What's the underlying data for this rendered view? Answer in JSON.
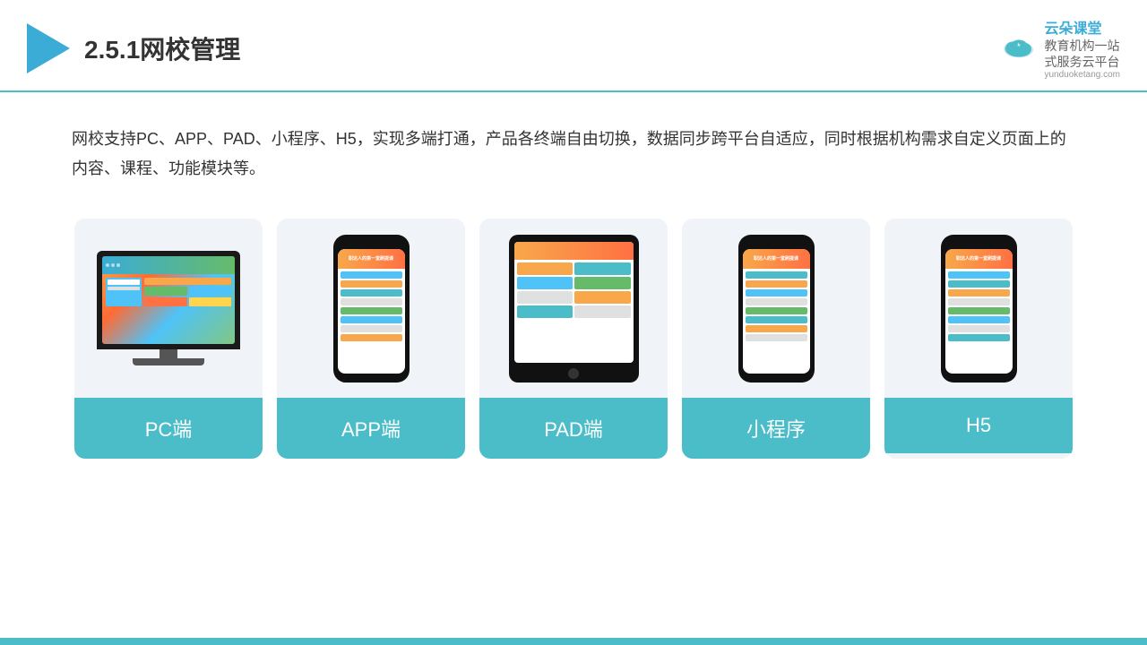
{
  "header": {
    "title": "2.5.1网校管理",
    "brand": {
      "name": "云朵课堂",
      "tagline": "教育机构一站\n式服务云平台",
      "url": "yunduoketang.com"
    }
  },
  "description": {
    "text": "网校支持PC、APP、PAD、小程序、H5，实现多端打通，产品各终端自由切换，数据同步跨平台自适应，同时根据机构需求自定义页面上的内容、课程、功能模块等。"
  },
  "cards": [
    {
      "id": "pc",
      "label": "PC端"
    },
    {
      "id": "app",
      "label": "APP端"
    },
    {
      "id": "pad",
      "label": "PAD端"
    },
    {
      "id": "miniprogram",
      "label": "小程序"
    },
    {
      "id": "h5",
      "label": "H5"
    }
  ],
  "colors": {
    "accent": "#4ABDC8",
    "triangle": "#3BACD6",
    "text_dark": "#333333",
    "label_bg": "#4ABDC8"
  }
}
